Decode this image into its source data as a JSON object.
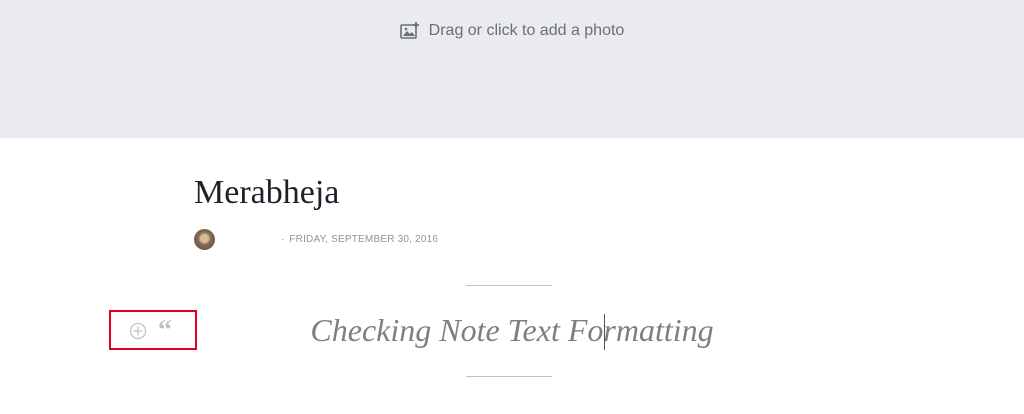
{
  "photo_area": {
    "label": "Drag or click to add a photo",
    "icon": "add-photo-icon"
  },
  "note": {
    "title": "Merabheja",
    "author_avatar": "avatar",
    "separator": "·",
    "date": "FRIDAY, SEPTEMBER 30, 2016"
  },
  "block_tools": {
    "add_icon": "plus-circle-icon",
    "quote_icon": "quote-icon",
    "quote_glyph": "“"
  },
  "body": {
    "quote_text": "Checking Note Text Formatting"
  },
  "colors": {
    "photo_bg": "#e9ebee",
    "highlight_border": "#e0001b",
    "title": "#1d2129",
    "muted": "#90949c"
  }
}
